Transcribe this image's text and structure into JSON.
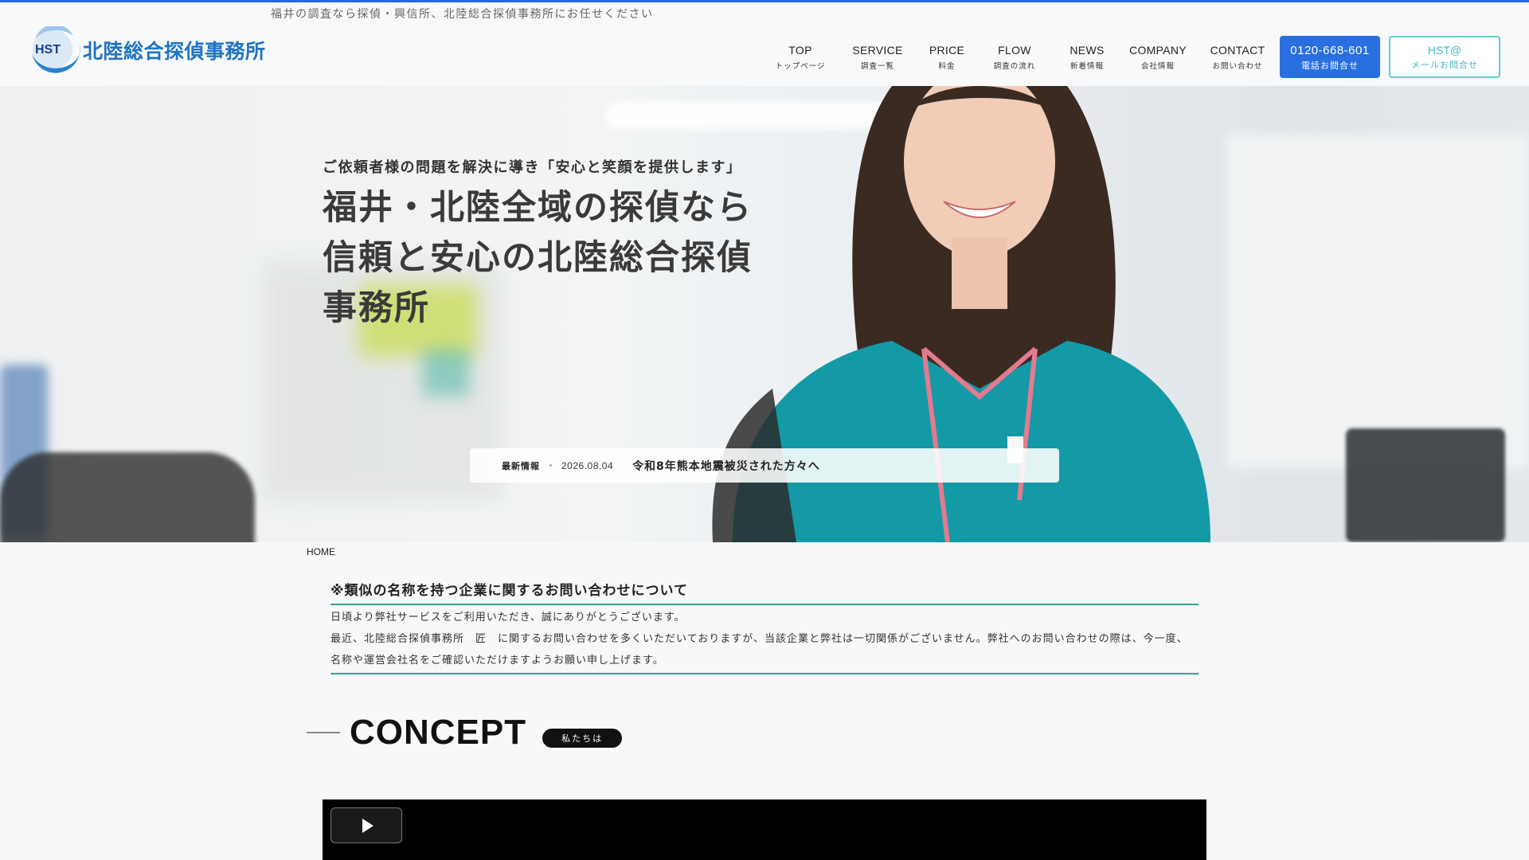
{
  "header": {
    "tagline": "福井の調査なら探偵・興信所、北陸総合探偵事務所にお任せください",
    "logo": {
      "mark_text": "HST",
      "name": "北陸総合探偵事務所"
    },
    "nav": [
      {
        "en": "TOP",
        "ja": "トップページ"
      },
      {
        "en": "SERVICE",
        "ja": "調査一覧"
      },
      {
        "en": "PRICE",
        "ja": "料金"
      },
      {
        "en": "FLOW",
        "ja": "調査の流れ"
      },
      {
        "en": "NEWS",
        "ja": "新着情報"
      },
      {
        "en": "COMPANY",
        "ja": "会社情報"
      },
      {
        "en": "CONTACT",
        "ja": "お問い合わせ"
      }
    ],
    "phone_button": {
      "number": "0120-668-601",
      "label": "電話お問合せ"
    },
    "mail_button": {
      "title": "HST@",
      "label": "メールお問合せ"
    }
  },
  "hero": {
    "caption": "ご依頼者様の問題を解決に導き「安心と笑顔を提供します」",
    "title": "福井・北陸全域の探偵なら信頼と安心の北陸総合探偵事務所",
    "news": {
      "label": "最新情報",
      "date": "2026.08.04",
      "title": "令和8年熊本地震被災された方々へ"
    }
  },
  "breadcrumb": "HOME",
  "notice": {
    "title": "※類似の名称を持つ企業に関するお問い合わせについて",
    "line1": "日頃より弊社サービスをご利用いただき、誠にありがとうございます。",
    "line2": "最近、北陸総合探偵事務所　匠　に関するお問い合わせを多くいただいておりますが、当該企業と弊社は一切関係がございません。弊社へのお問い合わせの際は、今一度、名称や運営会社名をご確認いただけますようお願い申し上げます。"
  },
  "concept": {
    "title": "CONCEPT",
    "badge": "私たちは"
  },
  "colors": {
    "accent": "#2a6fe0",
    "teal": "#3aa08c",
    "mail": "#47b7c8",
    "logo": "#1f74c2",
    "scrubs": "#139aa6"
  }
}
